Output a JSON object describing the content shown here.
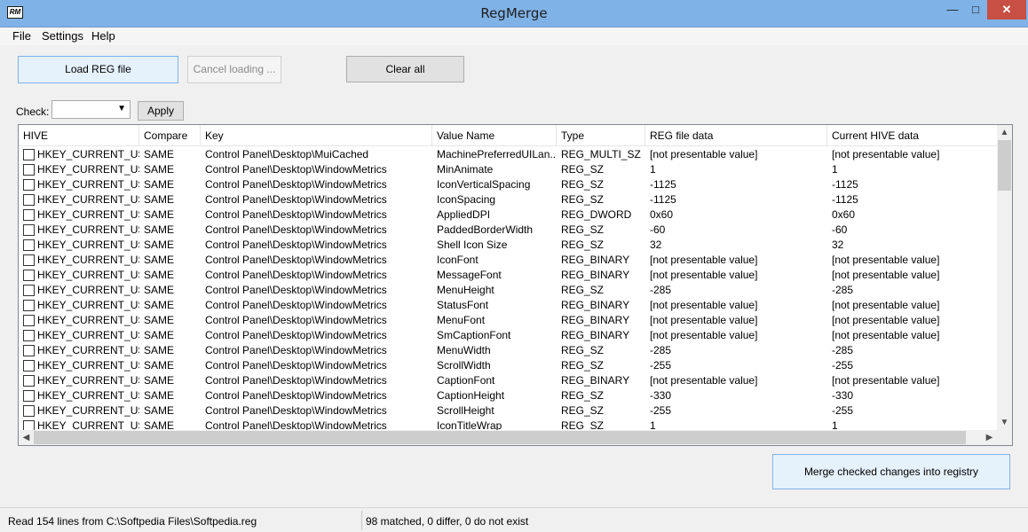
{
  "window": {
    "title": "RegMerge",
    "icon": "regmerge-app-icon",
    "icon_text": "RM"
  },
  "window_controls": {
    "minimize": "—",
    "maximize": "□",
    "close": "✕"
  },
  "menu": [
    "File",
    "Settings",
    "Help"
  ],
  "toolbar": {
    "load": "Load REG file",
    "cancel": "Cancel loading ...",
    "clear": "Clear all",
    "check_label": "Check:",
    "check_value": "",
    "apply": "Apply"
  },
  "table": {
    "columns": [
      "HIVE",
      "Compare",
      "Key",
      "Value Name",
      "Type",
      "REG file data",
      "Current HIVE data"
    ],
    "rows": [
      [
        "HKEY_CURRENT_USER",
        "SAME",
        "Control Panel\\Desktop\\MuiCached",
        "MachinePreferredUILan...",
        "REG_MULTI_SZ",
        "[not presentable value]",
        "[not presentable value]"
      ],
      [
        "HKEY_CURRENT_USER",
        "SAME",
        "Control Panel\\Desktop\\WindowMetrics",
        "MinAnimate",
        "REG_SZ",
        "1",
        "1"
      ],
      [
        "HKEY_CURRENT_USER",
        "SAME",
        "Control Panel\\Desktop\\WindowMetrics",
        "IconVerticalSpacing",
        "REG_SZ",
        "-1125",
        "-1125"
      ],
      [
        "HKEY_CURRENT_USER",
        "SAME",
        "Control Panel\\Desktop\\WindowMetrics",
        "IconSpacing",
        "REG_SZ",
        "-1125",
        "-1125"
      ],
      [
        "HKEY_CURRENT_USER",
        "SAME",
        "Control Panel\\Desktop\\WindowMetrics",
        "AppliedDPI",
        "REG_DWORD",
        "0x60",
        "0x60"
      ],
      [
        "HKEY_CURRENT_USER",
        "SAME",
        "Control Panel\\Desktop\\WindowMetrics",
        "PaddedBorderWidth",
        "REG_SZ",
        "-60",
        "-60"
      ],
      [
        "HKEY_CURRENT_USER",
        "SAME",
        "Control Panel\\Desktop\\WindowMetrics",
        "Shell Icon Size",
        "REG_SZ",
        "32",
        "32"
      ],
      [
        "HKEY_CURRENT_USER",
        "SAME",
        "Control Panel\\Desktop\\WindowMetrics",
        "IconFont",
        "REG_BINARY",
        "[not presentable value]",
        "[not presentable value]"
      ],
      [
        "HKEY_CURRENT_USER",
        "SAME",
        "Control Panel\\Desktop\\WindowMetrics",
        "MessageFont",
        "REG_BINARY",
        "[not presentable value]",
        "[not presentable value]"
      ],
      [
        "HKEY_CURRENT_USER",
        "SAME",
        "Control Panel\\Desktop\\WindowMetrics",
        "MenuHeight",
        "REG_SZ",
        "-285",
        "-285"
      ],
      [
        "HKEY_CURRENT_USER",
        "SAME",
        "Control Panel\\Desktop\\WindowMetrics",
        "StatusFont",
        "REG_BINARY",
        "[not presentable value]",
        "[not presentable value]"
      ],
      [
        "HKEY_CURRENT_USER",
        "SAME",
        "Control Panel\\Desktop\\WindowMetrics",
        "MenuFont",
        "REG_BINARY",
        "[not presentable value]",
        "[not presentable value]"
      ],
      [
        "HKEY_CURRENT_USER",
        "SAME",
        "Control Panel\\Desktop\\WindowMetrics",
        "SmCaptionFont",
        "REG_BINARY",
        "[not presentable value]",
        "[not presentable value]"
      ],
      [
        "HKEY_CURRENT_USER",
        "SAME",
        "Control Panel\\Desktop\\WindowMetrics",
        "MenuWidth",
        "REG_SZ",
        "-285",
        "-285"
      ],
      [
        "HKEY_CURRENT_USER",
        "SAME",
        "Control Panel\\Desktop\\WindowMetrics",
        "ScrollWidth",
        "REG_SZ",
        "-255",
        "-255"
      ],
      [
        "HKEY_CURRENT_USER",
        "SAME",
        "Control Panel\\Desktop\\WindowMetrics",
        "CaptionFont",
        "REG_BINARY",
        "[not presentable value]",
        "[not presentable value]"
      ],
      [
        "HKEY_CURRENT_USER",
        "SAME",
        "Control Panel\\Desktop\\WindowMetrics",
        "CaptionHeight",
        "REG_SZ",
        "-330",
        "-330"
      ],
      [
        "HKEY_CURRENT_USER",
        "SAME",
        "Control Panel\\Desktop\\WindowMetrics",
        "ScrollHeight",
        "REG_SZ",
        "-255",
        "-255"
      ],
      [
        "HKEY_CURRENT_USER",
        "SAME",
        "Control Panel\\Desktop\\WindowMetrics",
        "IconTitleWrap",
        "REG_SZ",
        "1",
        "1"
      ]
    ]
  },
  "scroll_arrows": {
    "up": "▲",
    "down": "▼",
    "left": "◀",
    "right": "▶"
  },
  "merge_button": "Merge checked changes into registry",
  "status": {
    "left": "Read 154 lines from C:\\Softpedia Files\\Softpedia.reg",
    "right": "98 matched, 0 differ, 0 do not exist"
  },
  "colors": {
    "titlebar": "#7fb2e6",
    "close_button": "#c74f43",
    "primary_button_bg": "#e5f1fb",
    "primary_button_border": "#7eb4ea"
  }
}
